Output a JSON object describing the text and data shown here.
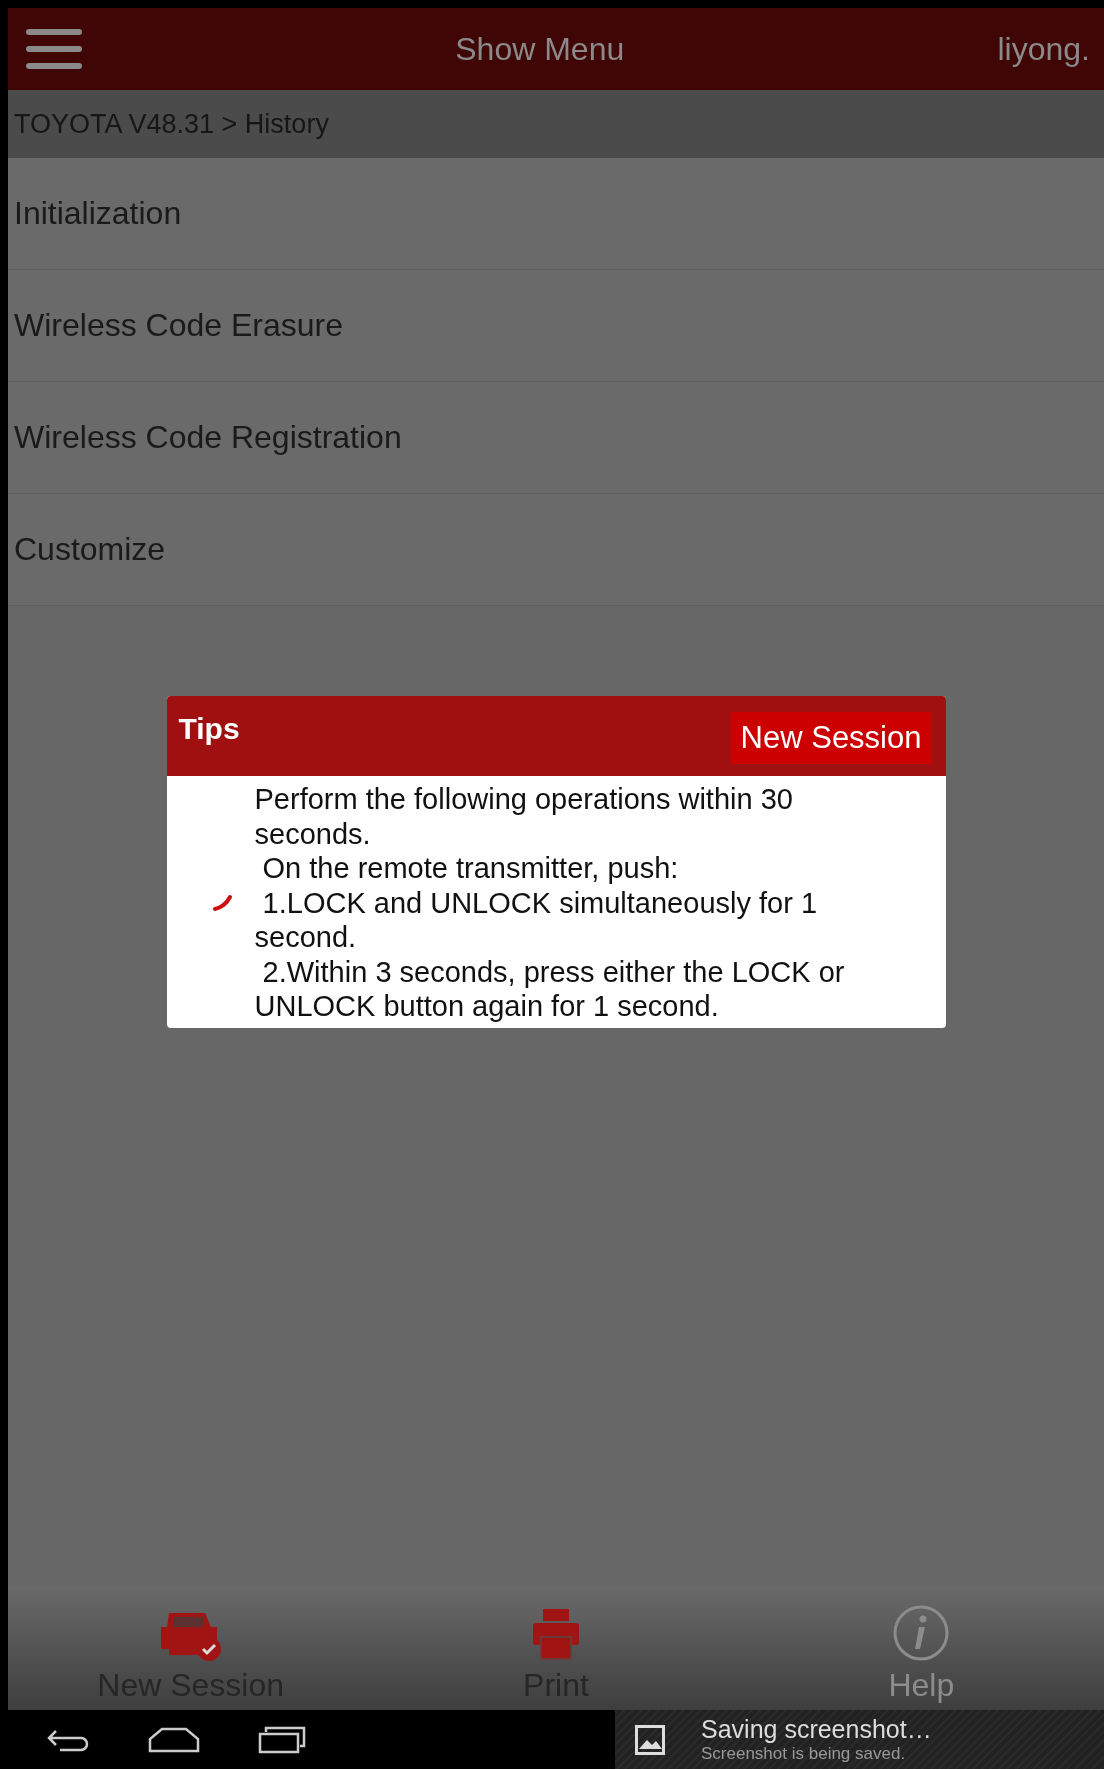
{
  "top_bar": {
    "title": "Show Menu",
    "user": "liyong."
  },
  "breadcrumb": "TOYOTA V48.31 > History",
  "menu_items": [
    {
      "label": "Initialization"
    },
    {
      "label": "Wireless Code Erasure"
    },
    {
      "label": "Wireless Code Registration"
    },
    {
      "label": "Customize"
    }
  ],
  "dialog": {
    "title": "Tips",
    "action": "New Session",
    "lines": [
      "Perform the following operations within 30 seconds.",
      " On the remote transmitter, push:",
      " 1.LOCK and UNLOCK simultaneously for 1 second.",
      " 2.Within 3 seconds, press either the LOCK or UNLOCK button again for 1 second."
    ]
  },
  "toolbar": [
    {
      "kind": "car",
      "label": "New Session",
      "disabled": false
    },
    {
      "kind": "print",
      "label": "Print",
      "disabled": false
    },
    {
      "kind": "help",
      "label": "Help",
      "disabled": true
    }
  ],
  "notification": {
    "title": "Saving screenshot…",
    "text": "Screenshot is being saved."
  }
}
